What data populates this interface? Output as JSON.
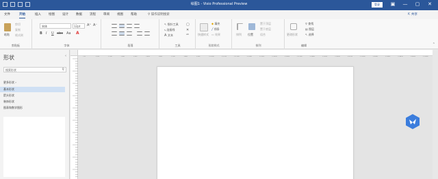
{
  "titlebar": {
    "title": "绘图1 - Visio Professional Preview",
    "signin_label": "登录",
    "window_controls": [
      "▣",
      "—",
      "▢",
      "✕"
    ],
    "qat_icons": [
      "save-icon",
      "undo-icon",
      "redo-icon",
      "customize-icon"
    ]
  },
  "tabs": {
    "items": [
      "文件",
      "开始",
      "插入",
      "绘图",
      "设计",
      "数据",
      "流程",
      "审阅",
      "视图",
      "帮助"
    ],
    "active": "开始",
    "tell_me": "操作说明搜索",
    "share_label": "共享"
  },
  "ribbon": {
    "groups": {
      "clipboard": {
        "label": "剪贴板",
        "paste": "粘贴",
        "cut": "剪切",
        "copy": "复制",
        "format_painter": "格式刷"
      },
      "font": {
        "label": "字体",
        "font_name": "宋体",
        "font_size": "12pt"
      },
      "paragraph": {
        "label": "段落"
      },
      "tools": {
        "label": "工具",
        "pointer": "指针工具",
        "connector": "连接线",
        "text": "文本"
      },
      "shape_styles": {
        "label": "形状样式",
        "quick_styles": "快速样式",
        "fill": "填充",
        "line": "线条",
        "effects": "效果"
      },
      "arrange": {
        "label": "排列",
        "align": "排列",
        "position": "位置",
        "bring_forward": "置于顶层",
        "send_backward": "置于底层",
        "group": "组合"
      },
      "editing": {
        "label": "编辑",
        "change_shape": "更改形状",
        "find": "查找",
        "layers": "图层",
        "select": "选择"
      }
    }
  },
  "shapes_pane": {
    "title": "形状",
    "search_placeholder": "搜索形状",
    "more_shapes": "更多形状",
    "stencils": [
      {
        "label": "基本形状",
        "selected": true
      },
      {
        "label": "箭头形状",
        "selected": false
      },
      {
        "label": "装饰形状",
        "selected": false
      },
      {
        "label": "图表和数学图形",
        "selected": false
      }
    ]
  },
  "ruler_ticks": [
    "0",
    "10",
    "20",
    "30",
    "40",
    "50",
    "60",
    "70",
    "80",
    "90",
    "100",
    "110",
    "120",
    "130",
    "140",
    "150",
    "160",
    "170",
    "180",
    "190",
    "200",
    "210",
    "220",
    "230",
    "240",
    "250",
    "260",
    "270"
  ],
  "colors": {
    "accent": "#2b579a",
    "canvas": "#e4e4e4",
    "page": "#ffffff",
    "floating_button": "#3b7ddd",
    "font_color_red": "#e03a3a"
  }
}
